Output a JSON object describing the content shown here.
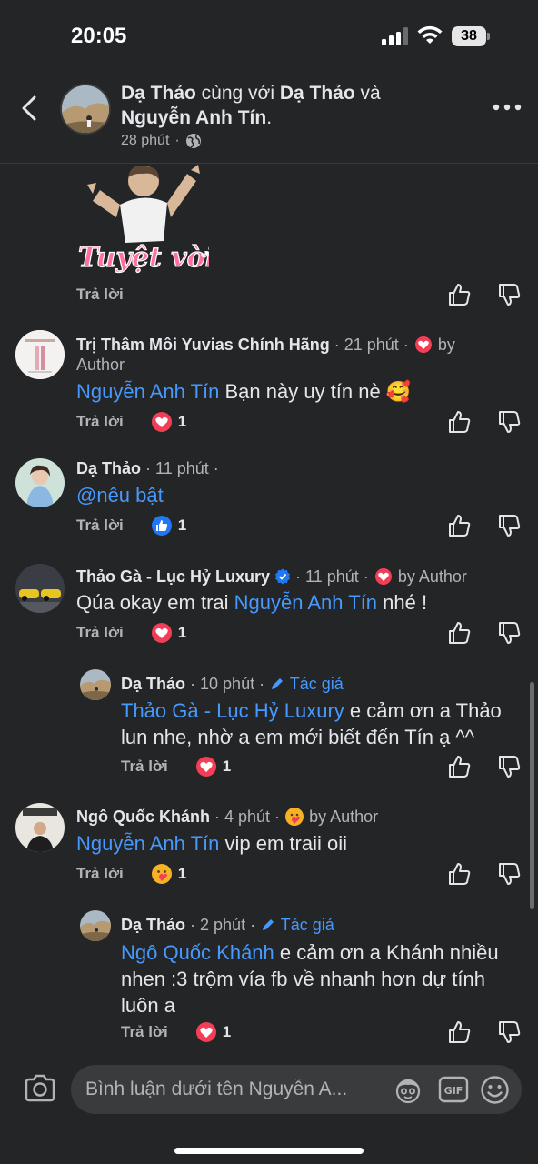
{
  "status_bar": {
    "time": "20:05",
    "battery": "38"
  },
  "header": {
    "author_name": "Dạ Thảo",
    "with_text": " cùng với ",
    "tagged_1": "Dạ Thảo",
    "and_text": " và ",
    "tagged_2": "Nguyễn Anh Tín",
    "period": ".",
    "time": "28 phút",
    "dot": "·"
  },
  "sticker": {
    "caption": "Tuyệt vời!"
  },
  "comments": [
    {
      "name": "Trị Thâm Môi Yuvias Chính Hãng",
      "time": "· 21 phút ·",
      "author_tag": "by",
      "author_tag_2": "Author",
      "mention": "Nguyễn Anh Tín",
      "text": " Bạn này uy tín nè 🥰",
      "reply": "Trả lời",
      "reaction_count": "1"
    },
    {
      "name": "Dạ Thảo",
      "time": "· 11 phút ·",
      "text": "@nêu bật",
      "reply": "Trả lời",
      "reaction_count": "1"
    },
    {
      "name": "Thảo Gà - Lục Hỷ Luxury",
      "time": "· 11 phút ·",
      "author_tag": "by Author",
      "text_before": "Qúa okay em trai ",
      "mention": "Nguyễn Anh Tín",
      "text_after": " nhé !",
      "reply": "Trả lời",
      "reaction_count": "1"
    },
    {
      "name": "Dạ Thảo",
      "time": "· 10 phút ·",
      "author_label": "Tác giả",
      "mention": "Thảo Gà - Lục Hỷ Luxury",
      "text_line1": " e cảm ơn a Thảo",
      "text_line2": "lun nhe, nhờ a em mới biết đến Tín ạ ^^",
      "reply": "Trả lời",
      "reaction_count": "1"
    },
    {
      "name": "Ngô Quốc Khánh",
      "time": "· 4 phút ·",
      "author_tag": "by Author",
      "mention": "Nguyễn Anh Tín",
      "text": " vip em traii oii",
      "reply": "Trả lời",
      "reaction_count": "1"
    },
    {
      "name": "Dạ Thảo",
      "time": "· 2 phút ·",
      "author_label": "Tác giả",
      "mention": "Ngô Quốc Khánh",
      "text_line1": " e cảm ơn a Khánh nhiều",
      "text_line2": "nhen :3 trộm vía fb về nhanh hơn dự tính",
      "text_line3": "luôn a",
      "reply": "Trả lời",
      "reaction_count": "1"
    }
  ],
  "first_reply": "Trả lời",
  "composer": {
    "placeholder": "Bình luận dưới tên Nguyễn A...",
    "gif_label": "GIF"
  },
  "colors": {
    "background": "#242526",
    "mention": "#4599ff",
    "heart": "#f33e58",
    "like": "#2078f4"
  }
}
